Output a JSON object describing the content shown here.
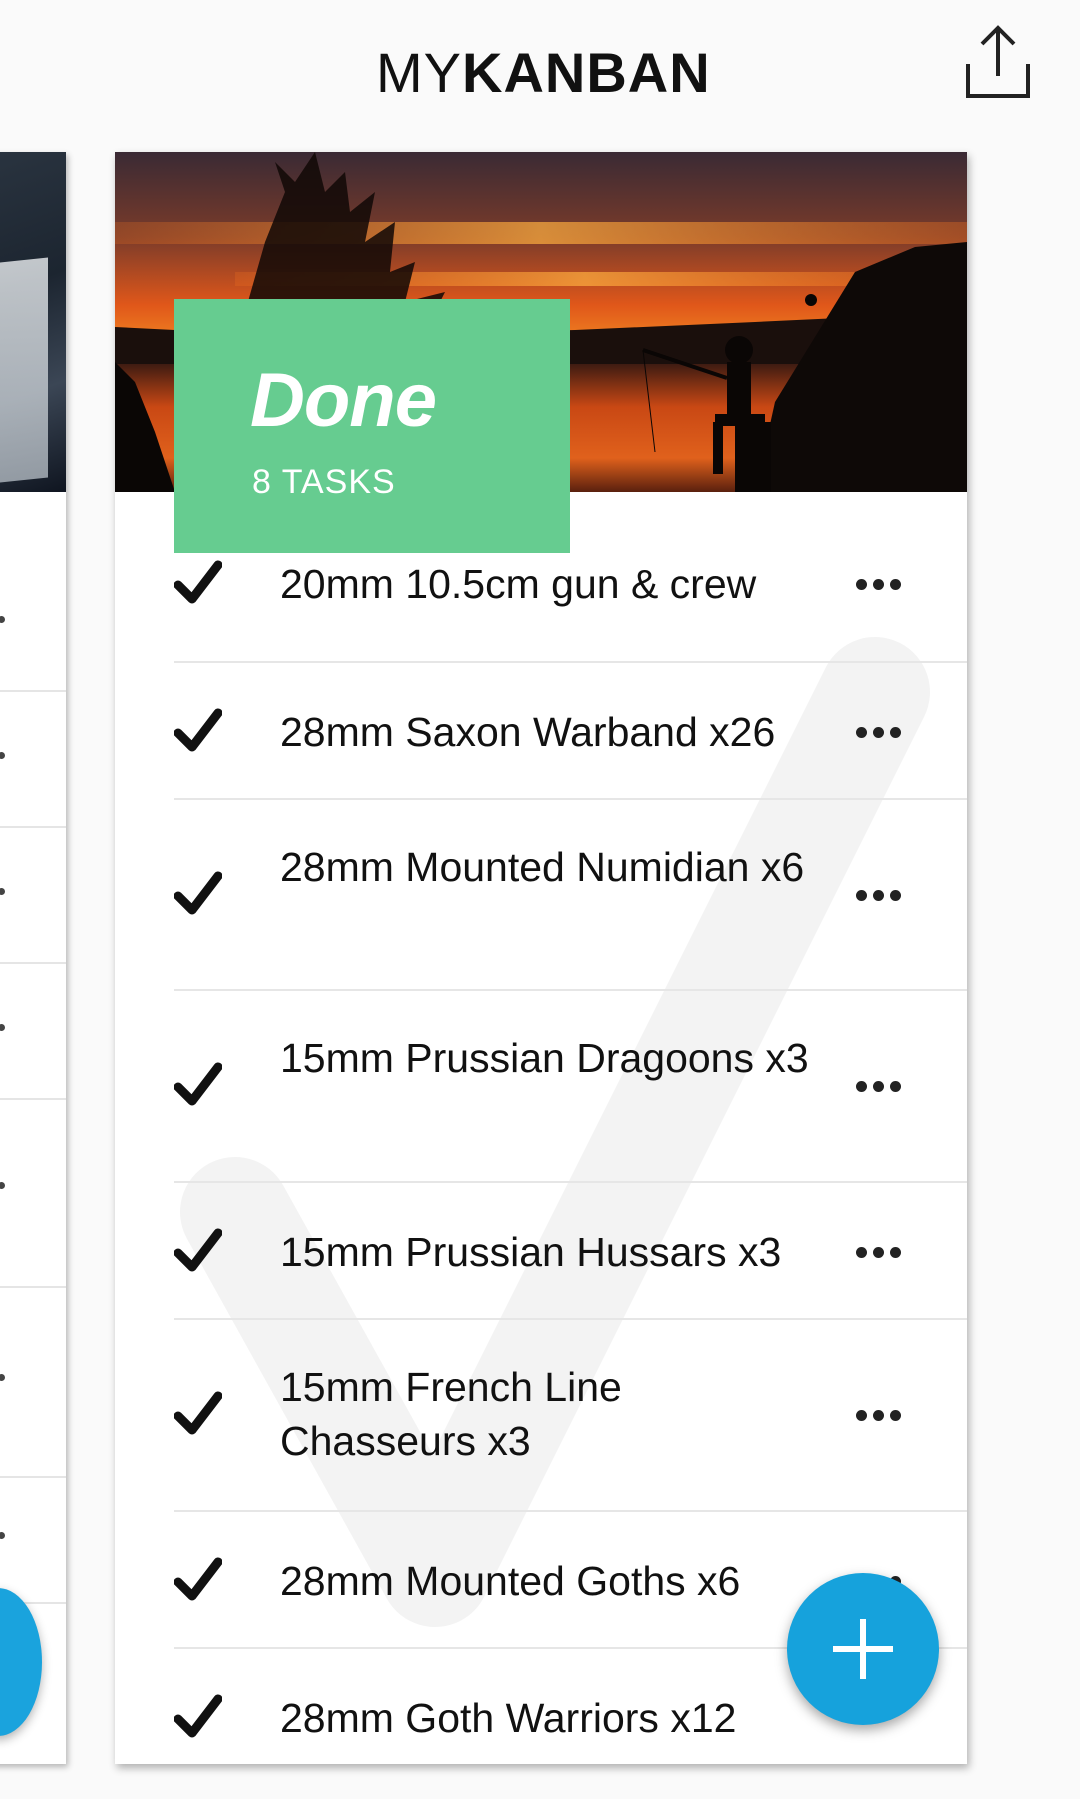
{
  "app": {
    "logo_light": "MY",
    "logo_bold": "KANBAN",
    "share_icon": "share-upload-icon"
  },
  "column": {
    "title": "Done",
    "task_count": "8 TASKS",
    "tag_color": "#66cc90"
  },
  "tasks": [
    {
      "label": "20mm 10.5cm gun & crew",
      "done": true
    },
    {
      "label": "28mm Saxon Warband x26",
      "done": true
    },
    {
      "label": "28mm Mounted Numidian x6",
      "done": true
    },
    {
      "label": "15mm Prussian Dragoons x3",
      "done": true
    },
    {
      "label": "15mm Prussian Hussars x3",
      "done": true
    },
    {
      "label": "15mm French Line Chasseurs x3",
      "done": true
    },
    {
      "label": "28mm Mounted Goths x6",
      "done": true
    },
    {
      "label": "28mm Goth Warriors x12",
      "done": true
    }
  ],
  "colors": {
    "accent": "#16a2dc",
    "done_green": "#66cc90",
    "background": "#fafafa"
  }
}
